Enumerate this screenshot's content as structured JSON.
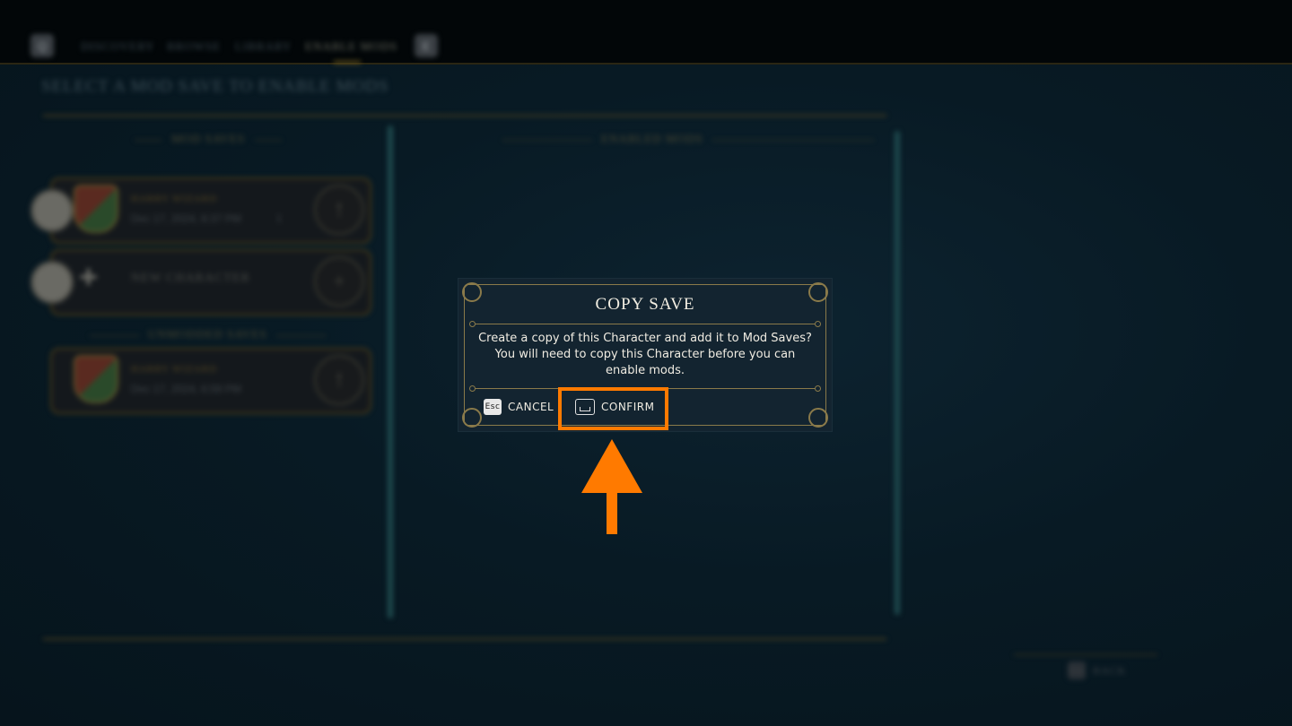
{
  "nav": {
    "left_key": "Q",
    "right_key": "E",
    "tabs": [
      {
        "label": "DISCOVERY"
      },
      {
        "label": "BROWSE"
      },
      {
        "label": "LIBRARY"
      },
      {
        "label": "ENABLE MODS"
      }
    ]
  },
  "page_title": "SELECT A MOD SAVE TO ENABLE MODS",
  "sections": {
    "mod_saves": "MOD SAVES",
    "enabled_mods": "ENABLED MODS",
    "unmodded_saves": "UNMODDED SAVES"
  },
  "mod_saves": [
    {
      "name": "HARRY WIZARD",
      "date": "Dec 17, 2024, 8:37 PM",
      "count": "1",
      "action": "!"
    }
  ],
  "new_character": {
    "label": "NEW CHARACTER",
    "plus": "+"
  },
  "unmodded_saves": [
    {
      "name": "HARRY WIZARD",
      "date": "Dec 17, 2024, 6:58 PM",
      "action": "!"
    }
  ],
  "back": {
    "key": "Esc",
    "label": "BACK"
  },
  "dialog": {
    "title": "COPY SAVE",
    "body_line1": "Create a copy of this Character and add it to Mod Saves?",
    "body_line2": "You will need to copy this Character before you can",
    "body_line3": "enable mods.",
    "cancel_key": "Esc",
    "cancel_label": "CANCEL",
    "confirm_label": "CONFIRM"
  },
  "colors": {
    "highlight": "#ff7a00",
    "dialog_bg": "#132430",
    "gold": "#8a7a4a"
  }
}
